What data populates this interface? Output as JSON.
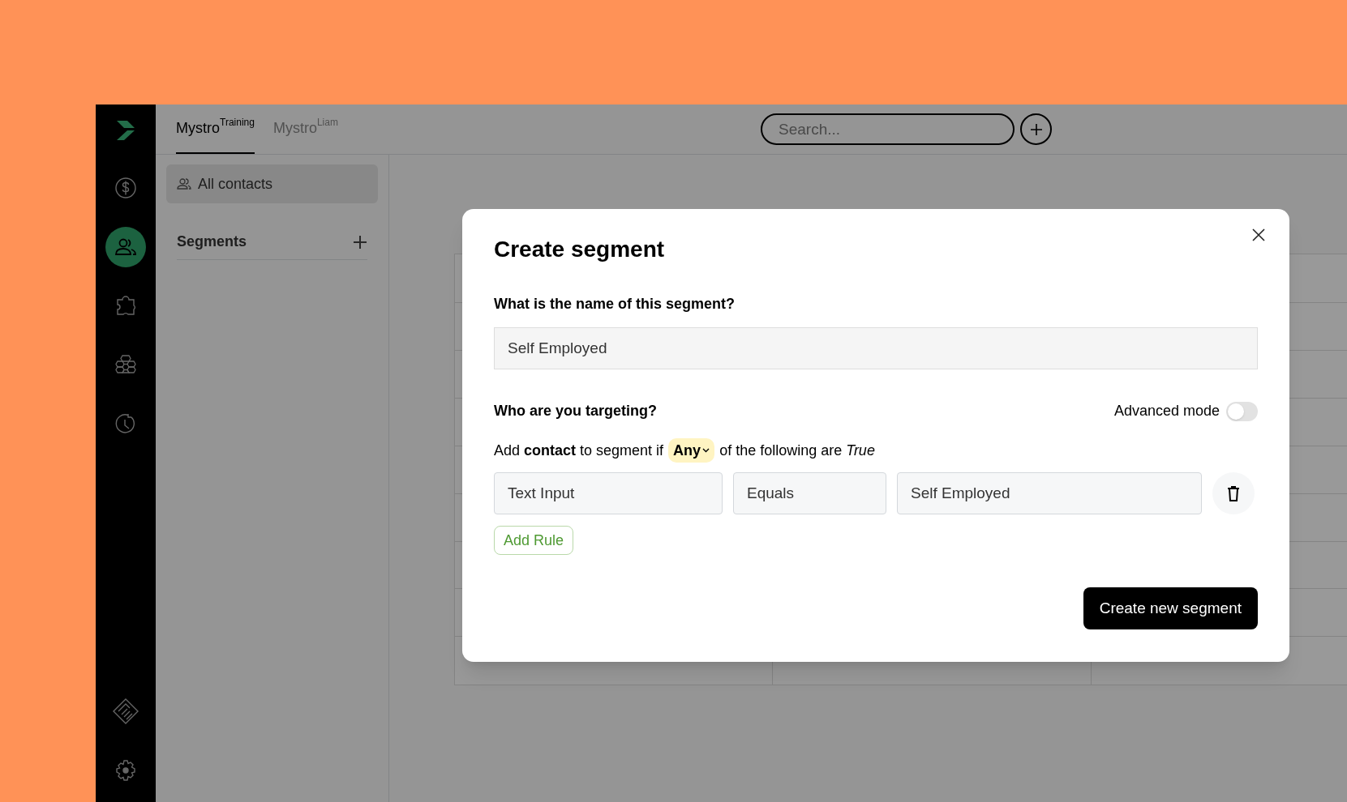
{
  "rail": {
    "items": [
      {
        "kind": "dollar",
        "selected": false
      },
      {
        "kind": "contacts",
        "selected": true
      },
      {
        "kind": "puzzle",
        "selected": false
      },
      {
        "kind": "hexagons",
        "selected": false
      },
      {
        "kind": "history",
        "selected": false
      },
      {
        "kind": "handshake",
        "selected": false
      },
      {
        "kind": "settings",
        "selected": false
      }
    ]
  },
  "tabs": [
    {
      "label": "Mystro",
      "sup": "Training",
      "selected": true
    },
    {
      "label": "Mystro",
      "sup": "Liam",
      "selected": false
    }
  ],
  "search": {
    "placeholder": "Search..."
  },
  "sidebar": {
    "items": [
      {
        "label": "All contacts",
        "selected": true
      }
    ],
    "section_title": "Segments"
  },
  "modal": {
    "title": "Create segment",
    "name_question": "What is the name of this segment?",
    "name_value": "Self Employed",
    "targeting_title": "Who are you targeting?",
    "advanced_mode": {
      "label": "Advanced mode",
      "on": false
    },
    "condition": {
      "prefix": "Add **contact** to segment if",
      "match": "Any",
      "suffix": "of the following are *True*"
    },
    "rules": [
      {
        "field": "Text Input",
        "operator": "Equals",
        "value": "Self Employed"
      }
    ],
    "add_rule": "Add Rule",
    "submit": "Create new segment"
  }
}
